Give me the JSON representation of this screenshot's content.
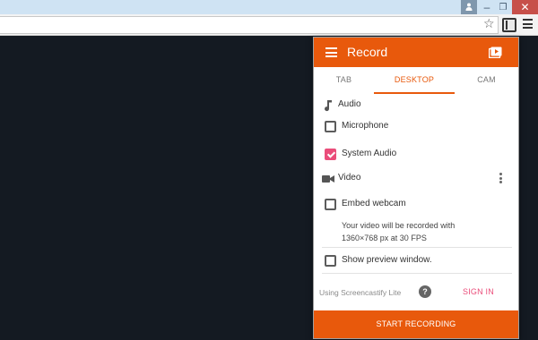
{
  "window": {
    "profile_icon": "person-icon",
    "minimize_glyph": "–",
    "maximize_glyph": "❐",
    "close_glyph": "✕"
  },
  "toolbar": {
    "star_glyph": "☆",
    "extension_icon": "film-strip-icon",
    "menu_icon": "hamburger-icon"
  },
  "popup": {
    "title": "Record",
    "tabs": [
      {
        "label": "TAB",
        "active": false
      },
      {
        "label": "DESKTOP",
        "active": true
      },
      {
        "label": "CAM",
        "active": false
      }
    ],
    "audio": {
      "section_label": "Audio",
      "options": [
        {
          "label": "Microphone",
          "checked": false
        },
        {
          "label": "System Audio",
          "checked": true
        }
      ]
    },
    "video": {
      "section_label": "Video",
      "embed_webcam": {
        "label": "Embed webcam",
        "checked": false
      },
      "info_line1": "Your video will be recorded with",
      "info_line2": "1360×768 px at 30 FPS"
    },
    "show_preview": {
      "label": "Show preview window.",
      "checked": false
    },
    "footer": {
      "lite_text": "Using Screencastify Lite",
      "help_glyph": "?",
      "sign_in_label": "SIGN IN"
    },
    "start_button_label": "START RECORDING"
  },
  "colors": {
    "accent": "#e8590c",
    "checkbox_checked": "#ea4d7a",
    "page_background": "#141a22"
  }
}
